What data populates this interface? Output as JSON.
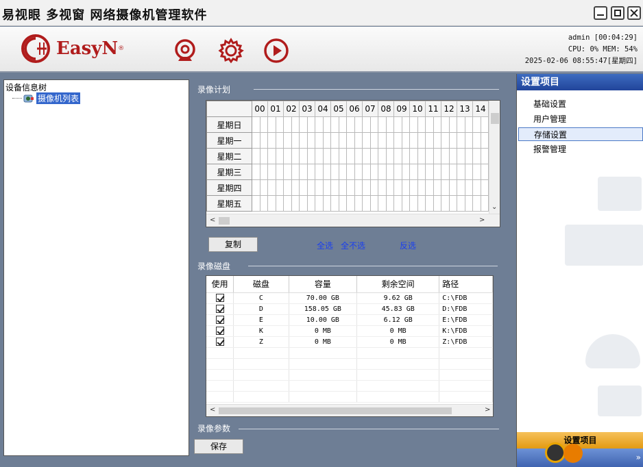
{
  "window": {
    "title": "易视眼 多视窗 网络摄像机管理软件"
  },
  "header": {
    "brand": "EasyN",
    "reg": "®",
    "sysinfo": {
      "line1": "admin [00:04:29]",
      "line2": "CPU:  0%  MEM: 54%",
      "line3": "2025-02-06 08:55:47[星期四]"
    }
  },
  "tree": {
    "root": "设备信息树",
    "child": "摄像机列表"
  },
  "schedule": {
    "label": "录像计划",
    "hours": [
      "00",
      "01",
      "02",
      "03",
      "04",
      "05",
      "06",
      "07",
      "08",
      "09",
      "10",
      "11",
      "12",
      "13",
      "14"
    ],
    "days": [
      "星期日",
      "星期一",
      "星期二",
      "星期三",
      "星期四",
      "星期五"
    ],
    "copy_button": "复制",
    "select_all": "全选",
    "select_none": "全不选",
    "invert": "反选"
  },
  "disks": {
    "label": "录像磁盘",
    "columns": [
      "使用",
      "磁盘",
      "容量",
      "剩余空间",
      "路径"
    ],
    "rows": [
      {
        "use": true,
        "disk": "C",
        "capacity": "70.00 GB",
        "free": "9.62 GB",
        "path": "C:\\FDB"
      },
      {
        "use": true,
        "disk": "D",
        "capacity": "158.05 GB",
        "free": "45.83 GB",
        "path": "D:\\FDB"
      },
      {
        "use": true,
        "disk": "E",
        "capacity": "10.00 GB",
        "free": "6.12 GB",
        "path": "E:\\FDB"
      },
      {
        "use": true,
        "disk": "K",
        "capacity": "0 MB",
        "free": "0 MB",
        "path": "K:\\FDB"
      },
      {
        "use": true,
        "disk": "Z",
        "capacity": "0 MB",
        "free": "0 MB",
        "path": "Z:\\FDB"
      }
    ]
  },
  "params": {
    "label": "录像参数",
    "save_button": "保存"
  },
  "settings": {
    "header": "设置项目",
    "items": [
      "基础设置",
      "用户管理",
      "存储设置",
      "报警管理"
    ],
    "selected": "存储设置",
    "footer": "设置项目",
    "more": "»"
  },
  "colors": {
    "accent": "#21449a",
    "link": "#1a3ff0",
    "brand": "#b01c1c",
    "panel_bg": "#6e7e95"
  }
}
